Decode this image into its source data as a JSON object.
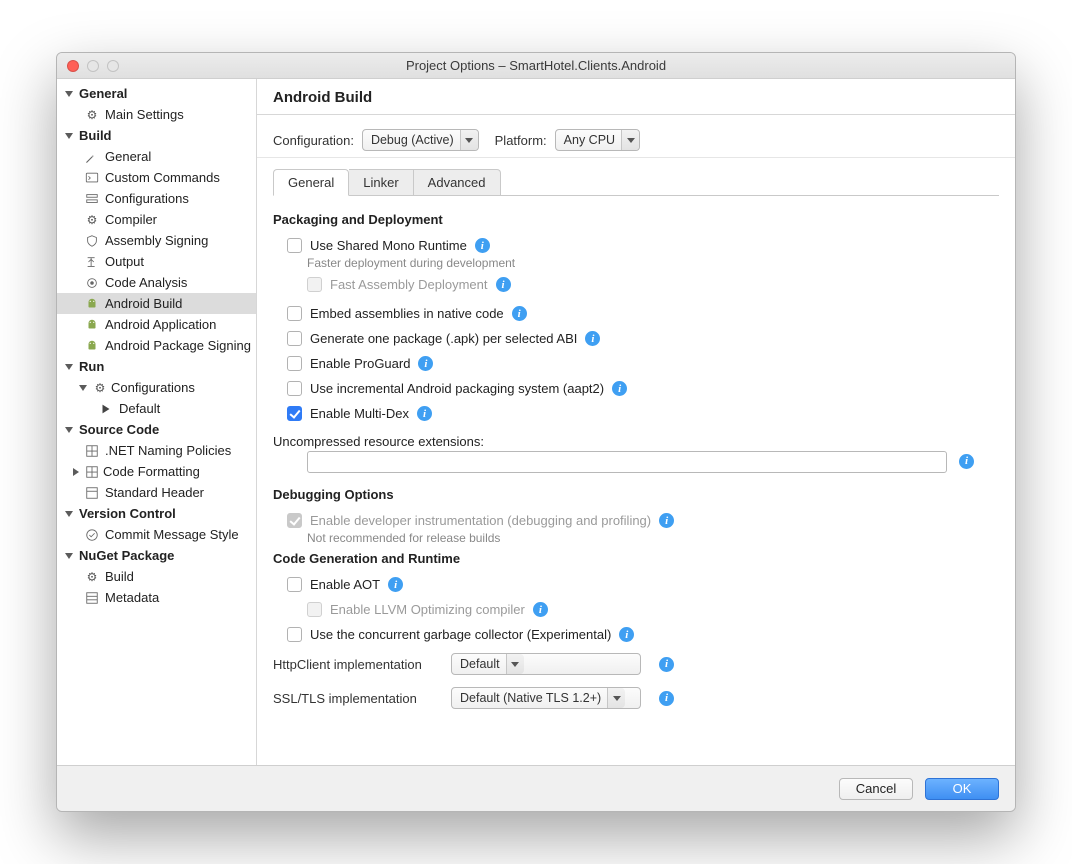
{
  "window": {
    "title": "Project Options – SmartHotel.Clients.Android"
  },
  "sidebar": {
    "groups": [
      {
        "label": "General",
        "items": [
          {
            "icon": "gear",
            "label": "Main Settings"
          }
        ]
      },
      {
        "label": "Build",
        "items": [
          {
            "icon": "wrench",
            "label": "General"
          },
          {
            "icon": "terminal",
            "label": "Custom Commands"
          },
          {
            "icon": "stack",
            "label": "Configurations"
          },
          {
            "icon": "gear-dbl",
            "label": "Compiler"
          },
          {
            "icon": "shield",
            "label": "Assembly Signing"
          },
          {
            "icon": "out",
            "label": "Output"
          },
          {
            "icon": "target",
            "label": "Code Analysis"
          },
          {
            "icon": "android",
            "label": "Android Build",
            "selected": true
          },
          {
            "icon": "android",
            "label": "Android Application"
          },
          {
            "icon": "android",
            "label": "Android Package Signing"
          }
        ]
      },
      {
        "label": "Run",
        "items": [
          {
            "icon": "gear",
            "label": "Configurations",
            "children": [
              {
                "icon": "play",
                "label": "Default"
              }
            ]
          }
        ]
      },
      {
        "label": "Source Code",
        "items": [
          {
            "icon": "grid",
            "label": ".NET Naming Policies"
          },
          {
            "icon": "grid",
            "label": "Code Formatting",
            "expandable": true
          },
          {
            "icon": "grid",
            "label": "Standard Header"
          }
        ]
      },
      {
        "label": "Version Control",
        "items": [
          {
            "icon": "check",
            "label": "Commit Message Style"
          }
        ]
      },
      {
        "label": "NuGet Package",
        "items": [
          {
            "icon": "gear",
            "label": "Build"
          },
          {
            "icon": "grid",
            "label": "Metadata"
          }
        ]
      }
    ]
  },
  "main": {
    "heading": "Android Build",
    "configRow": {
      "configLabel": "Configuration:",
      "configValue": "Debug (Active)",
      "platformLabel": "Platform:",
      "platformValue": "Any CPU"
    },
    "tabs": [
      {
        "label": "General",
        "active": true
      },
      {
        "label": "Linker"
      },
      {
        "label": "Advanced"
      }
    ],
    "section1": {
      "title": "Packaging and Deployment",
      "opt_shared_mono": "Use Shared Mono Runtime",
      "opt_shared_mono_hint": "Faster deployment during development",
      "opt_fast_asm": "Fast Assembly Deployment",
      "opt_embed": "Embed assemblies in native code",
      "opt_oneapk": "Generate one package (.apk) per selected ABI",
      "opt_proguard": "Enable ProGuard",
      "opt_aapt2": "Use incremental Android packaging system (aapt2)",
      "opt_multidex": "Enable Multi-Dex",
      "uncompressed_label": "Uncompressed resource extensions:",
      "uncompressed_value": ""
    },
    "section2": {
      "title": "Debugging Options",
      "opt_devinst": "Enable developer instrumentation (debugging and profiling)",
      "opt_devinst_hint": "Not recommended for release builds"
    },
    "section3": {
      "title": "Code Generation and Runtime",
      "opt_aot": "Enable AOT",
      "opt_llvm": "Enable LLVM Optimizing compiler",
      "opt_concgc": "Use the concurrent garbage collector (Experimental)",
      "http_label": "HttpClient implementation",
      "http_value": "Default",
      "ssl_label": "SSL/TLS implementation",
      "ssl_value": "Default (Native TLS 1.2+)"
    }
  },
  "footer": {
    "cancel": "Cancel",
    "ok": "OK"
  }
}
